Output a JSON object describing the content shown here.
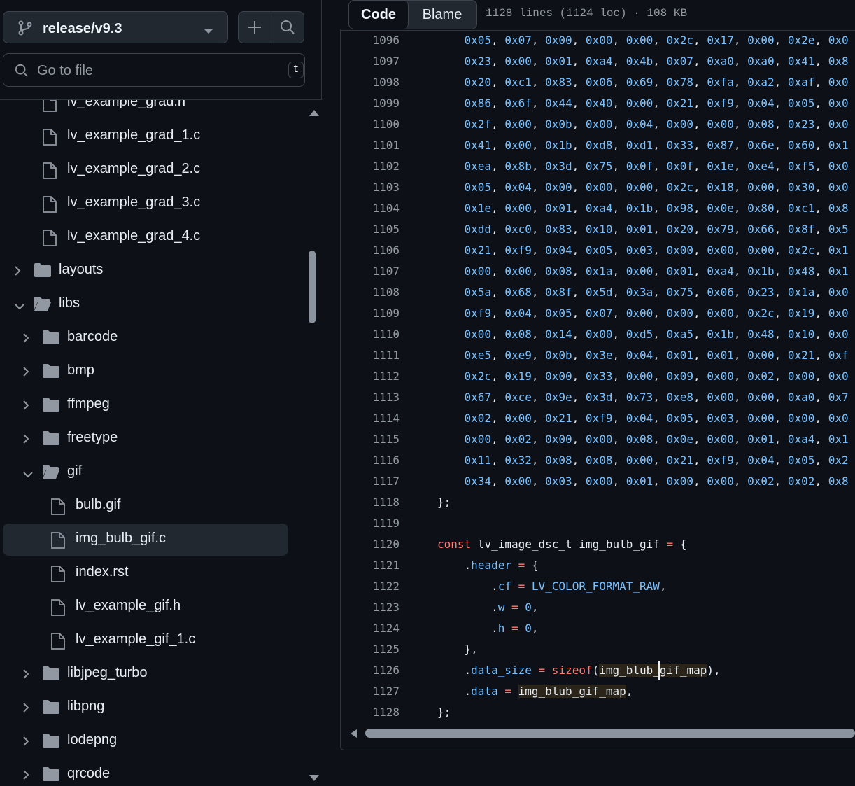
{
  "sidebar": {
    "branch": "release/v9.3",
    "goto_placeholder": "Go to file",
    "goto_shortcut": "t",
    "items": [
      {
        "label": "lv_example_grad.h",
        "type": "file",
        "level": 2
      },
      {
        "label": "lv_example_grad_1.c",
        "type": "file",
        "level": 2
      },
      {
        "label": "lv_example_grad_2.c",
        "type": "file",
        "level": 2
      },
      {
        "label": "lv_example_grad_3.c",
        "type": "file",
        "level": 2
      },
      {
        "label": "lv_example_grad_4.c",
        "type": "file",
        "level": 2
      },
      {
        "label": "layouts",
        "type": "folder",
        "level": 1,
        "expanded": false
      },
      {
        "label": "libs",
        "type": "folder",
        "level": 1,
        "expanded": true
      },
      {
        "label": "barcode",
        "type": "folder",
        "level": 2,
        "expanded": false
      },
      {
        "label": "bmp",
        "type": "folder",
        "level": 2,
        "expanded": false
      },
      {
        "label": "ffmpeg",
        "type": "folder",
        "level": 2,
        "expanded": false
      },
      {
        "label": "freetype",
        "type": "folder",
        "level": 2,
        "expanded": false
      },
      {
        "label": "gif",
        "type": "folder",
        "level": 2,
        "expanded": true
      },
      {
        "label": "bulb.gif",
        "type": "file",
        "level": 3
      },
      {
        "label": "img_bulb_gif.c",
        "type": "file",
        "level": 3,
        "selected": true
      },
      {
        "label": "index.rst",
        "type": "file",
        "level": 3
      },
      {
        "label": "lv_example_gif.h",
        "type": "file",
        "level": 3
      },
      {
        "label": "lv_example_gif_1.c",
        "type": "file",
        "level": 3
      },
      {
        "label": "libjpeg_turbo",
        "type": "folder",
        "level": 2,
        "expanded": false
      },
      {
        "label": "libpng",
        "type": "folder",
        "level": 2,
        "expanded": false
      },
      {
        "label": "lodepng",
        "type": "folder",
        "level": 2,
        "expanded": false
      },
      {
        "label": "qrcode",
        "type": "folder",
        "level": 2,
        "expanded": false
      }
    ]
  },
  "toolbar": {
    "code_tab": "Code",
    "blame_tab": "Blame",
    "file_info": "1128 lines (1124 loc) · 108 KB"
  },
  "code_lines": [
    {
      "n": "1096",
      "t": "    0x05, 0x07, 0x00, 0x00, 0x00, 0x2c, 0x17, 0x00, 0x2e, 0x0"
    },
    {
      "n": "1097",
      "t": "    0x23, 0x00, 0x01, 0xa4, 0x4b, 0x07, 0xa0, 0xa0, 0x41, 0x8"
    },
    {
      "n": "1098",
      "t": "    0x20, 0xc1, 0x83, 0x06, 0x69, 0x78, 0xfa, 0xa2, 0xaf, 0x0"
    },
    {
      "n": "1099",
      "t": "    0x86, 0x6f, 0x44, 0x40, 0x00, 0x21, 0xf9, 0x04, 0x05, 0x0"
    },
    {
      "n": "1100",
      "t": "    0x2f, 0x00, 0x0b, 0x00, 0x04, 0x00, 0x00, 0x08, 0x23, 0x0"
    },
    {
      "n": "1101",
      "t": "    0x41, 0x00, 0x1b, 0xd8, 0xd1, 0x33, 0x87, 0x6e, 0x60, 0x1"
    },
    {
      "n": "1102",
      "t": "    0xea, 0x8b, 0x3d, 0x75, 0x0f, 0x0f, 0x1e, 0xe4, 0xf5, 0x0"
    },
    {
      "n": "1103",
      "t": "    0x05, 0x04, 0x00, 0x00, 0x00, 0x2c, 0x18, 0x00, 0x30, 0x0"
    },
    {
      "n": "1104",
      "t": "    0x1e, 0x00, 0x01, 0xa4, 0x1b, 0x98, 0x0e, 0x80, 0xc1, 0x8"
    },
    {
      "n": "1105",
      "t": "    0xdd, 0xc0, 0x83, 0x10, 0x01, 0x20, 0x79, 0x66, 0x8f, 0x5"
    },
    {
      "n": "1106",
      "t": "    0x21, 0xf9, 0x04, 0x05, 0x03, 0x00, 0x00, 0x00, 0x2c, 0x1"
    },
    {
      "n": "1107",
      "t": "    0x00, 0x00, 0x08, 0x1a, 0x00, 0x01, 0xa4, 0x1b, 0x48, 0x1"
    },
    {
      "n": "1108",
      "t": "    0x5a, 0x68, 0x8f, 0x5d, 0x3a, 0x75, 0x06, 0x23, 0x1a, 0x0"
    },
    {
      "n": "1109",
      "t": "    0xf9, 0x04, 0x05, 0x07, 0x00, 0x00, 0x00, 0x2c, 0x19, 0x0"
    },
    {
      "n": "1110",
      "t": "    0x00, 0x08, 0x14, 0x00, 0xd5, 0xa5, 0x1b, 0x48, 0x10, 0x0"
    },
    {
      "n": "1111",
      "t": "    0xe5, 0xe9, 0x0b, 0x3e, 0x04, 0x01, 0x01, 0x00, 0x21, 0xf"
    },
    {
      "n": "1112",
      "t": "    0x2c, 0x19, 0x00, 0x33, 0x00, 0x09, 0x00, 0x02, 0x00, 0x0"
    },
    {
      "n": "1113",
      "t": "    0x67, 0xce, 0x9e, 0x3d, 0x73, 0xe8, 0x00, 0x00, 0xa0, 0x7"
    },
    {
      "n": "1114",
      "t": "    0x02, 0x00, 0x21, 0xf9, 0x04, 0x05, 0x03, 0x00, 0x00, 0x0"
    },
    {
      "n": "1115",
      "t": "    0x00, 0x02, 0x00, 0x00, 0x08, 0x0e, 0x00, 0x01, 0xa4, 0x1"
    },
    {
      "n": "1116",
      "t": "    0x11, 0x32, 0x08, 0x08, 0x00, 0x21, 0xf9, 0x04, 0x05, 0x2"
    },
    {
      "n": "1117",
      "t": "    0x34, 0x00, 0x03, 0x00, 0x01, 0x00, 0x00, 0x02, 0x02, 0x8"
    },
    {
      "n": "1118",
      "t": "};"
    },
    {
      "n": "1119",
      "t": ""
    },
    {
      "n": "1120",
      "t": "const lv_image_dsc_t img_bulb_gif = {"
    },
    {
      "n": "1121",
      "t": "    .header = {"
    },
    {
      "n": "1122",
      "t": "        .cf = LV_COLOR_FORMAT_RAW,"
    },
    {
      "n": "1123",
      "t": "        .w = 0,"
    },
    {
      "n": "1124",
      "t": "        .h = 0,"
    },
    {
      "n": "1125",
      "t": "    },"
    },
    {
      "n": "1126",
      "t": "    .data_size = sizeof(img_blub_gif_map),"
    },
    {
      "n": "1127",
      "t": "    .data = img_blub_gif_map,"
    },
    {
      "n": "1128",
      "t": "};"
    }
  ],
  "colors": {
    "background": "#0d1117",
    "border": "#30363d",
    "keyword": "#ff7b72",
    "property": "#79c0ff",
    "text": "#e6edf3",
    "muted": "#9198a1"
  }
}
